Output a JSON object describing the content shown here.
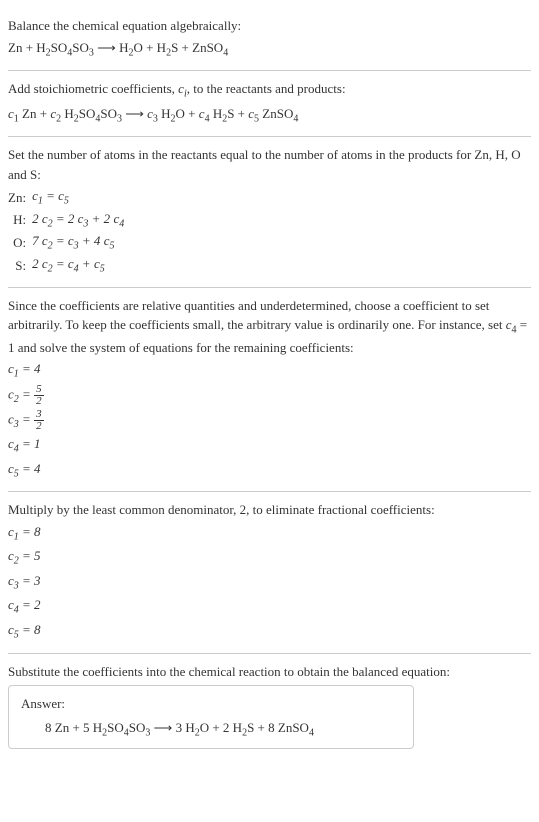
{
  "s1": {
    "p1": "Balance the chemical equation algebraically:",
    "eq": "Zn + H₂SO₄SO₃ ⟶ H₂O + H₂S + ZnSO₄"
  },
  "s2": {
    "p1_a": "Add stoichiometric coefficients, ",
    "p1_b": "c",
    "p1_c": "i",
    "p1_d": ", to the reactants and products:",
    "eq": "c₁ Zn + c₂ H₂SO₄SO₃ ⟶ c₃ H₂O + c₄ H₂S + c₅ ZnSO₄"
  },
  "s3": {
    "p1": "Set the number of atoms in the reactants equal to the number of atoms in the products for Zn, H, O and S:",
    "rows": [
      {
        "el": "Zn:",
        "eq": "c₁ = c₅"
      },
      {
        "el": "H:",
        "eq": "2 c₂ = 2 c₃ + 2 c₄"
      },
      {
        "el": "O:",
        "eq": "7 c₂ = c₃ + 4 c₅"
      },
      {
        "el": "S:",
        "eq": "2 c₂ = c₄ + c₅"
      }
    ]
  },
  "s4": {
    "p1_a": "Since the coefficients are relative quantities and underdetermined, choose a coefficient to set arbitrarily. To keep the coefficients small, the arbitrary value is ordinarily one. For instance, set ",
    "p1_b": "c₄ = 1",
    "p1_c": " and solve the system of equations for the remaining coefficients:",
    "c1": "c₁ = 4",
    "c2_a": "c₂ = ",
    "c2_num": "5",
    "c2_den": "2",
    "c3_a": "c₃ = ",
    "c3_num": "3",
    "c3_den": "2",
    "c4": "c₄ = 1",
    "c5": "c₅ = 4"
  },
  "s5": {
    "p1": "Multiply by the least common denominator, 2, to eliminate fractional coefficients:",
    "c1": "c₁ = 8",
    "c2": "c₂ = 5",
    "c3": "c₃ = 3",
    "c4": "c₄ = 2",
    "c5": "c₅ = 8"
  },
  "s6": {
    "p1": "Substitute the coefficients into the chemical reaction to obtain the balanced equation:"
  },
  "ans": {
    "label": "Answer:",
    "eq": "8 Zn + 5 H₂SO₄SO₃ ⟶ 3 H₂O + 2 H₂S + 8 ZnSO₄"
  }
}
